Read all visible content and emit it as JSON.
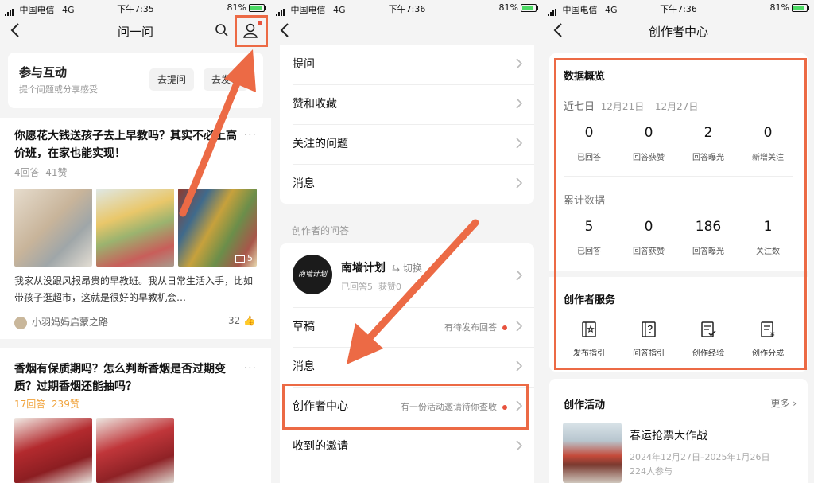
{
  "status": {
    "carrier": "中国电信",
    "network": "4G",
    "battery": "81%",
    "time_p1": "下午7:35",
    "time_p2": "下午7:36",
    "time_p3": "下午7:36"
  },
  "panel1": {
    "title": "问一问",
    "engage": {
      "title": "参与互动",
      "subtitle": "提个问题或分享感受",
      "ask_button": "去提问",
      "post_button": "去发布"
    },
    "questions": [
      {
        "title": "你愿花大钱送孩子去上早教吗？其实不必上高价班，在家也能实现！",
        "answers": "4回答",
        "likes": "41赞",
        "image_count": "5",
        "excerpt": "我家从没跟风报昂贵的早教班。我从日常生活入手，比如带孩子逛超市，这就是很好的早教机会…",
        "author": "小羽妈妈启蒙之路",
        "like_count": "32"
      },
      {
        "title": "香烟有保质期吗？怎么判断香烟是否过期变质？过期香烟还能抽吗？",
        "answers": "17回答",
        "likes": "239赞"
      }
    ]
  },
  "panel2": {
    "menu1": [
      "提问",
      "赞和收藏",
      "关注的问题",
      "消息"
    ],
    "section_label": "创作者的问答",
    "profile": {
      "avatar_text": "南墙计划",
      "name": "南墙计划",
      "switch_label": "切换",
      "stats": "已回答5  获赞0"
    },
    "menu2": [
      {
        "label": "草稿",
        "hint": "有待发布回答",
        "dot": true
      },
      {
        "label": "消息",
        "hint": "",
        "dot": false
      },
      {
        "label": "创作者中心",
        "hint": "有一份活动邀请待你查收",
        "dot": true
      },
      {
        "label": "收到的邀请",
        "hint": "",
        "dot": false
      }
    ]
  },
  "panel3": {
    "title": "创作者中心",
    "overview_title": "数据概览",
    "recent_label": "近七日",
    "recent_range": "12月21日 – 12月27日",
    "recent": [
      {
        "value": "0",
        "label": "已回答"
      },
      {
        "value": "0",
        "label": "回答获赞"
      },
      {
        "value": "2",
        "label": "回答曝光"
      },
      {
        "value": "0",
        "label": "新增关注"
      }
    ],
    "total_label": "累计数据",
    "total": [
      {
        "value": "5",
        "label": "已回答"
      },
      {
        "value": "0",
        "label": "回答获赞"
      },
      {
        "value": "186",
        "label": "回答曝光"
      },
      {
        "value": "1",
        "label": "关注数"
      }
    ],
    "services_title": "创作者服务",
    "services": [
      {
        "label": "发布指引",
        "icon": "publish-guide-icon"
      },
      {
        "label": "问答指引",
        "icon": "qa-guide-icon"
      },
      {
        "label": "创作经验",
        "icon": "experience-icon"
      },
      {
        "label": "创作分成",
        "icon": "revenue-share-icon"
      }
    ],
    "activity_title": "创作活动",
    "activity_more": "更多",
    "activity": {
      "name": "春运抢票大作战",
      "dates": "2024年12月27日–2025年1月26日",
      "participants": "224人参与"
    }
  },
  "colors": {
    "highlight": "#ec6a45",
    "badge_red": "#e8533e",
    "answer_orange": "#f0a23a"
  }
}
